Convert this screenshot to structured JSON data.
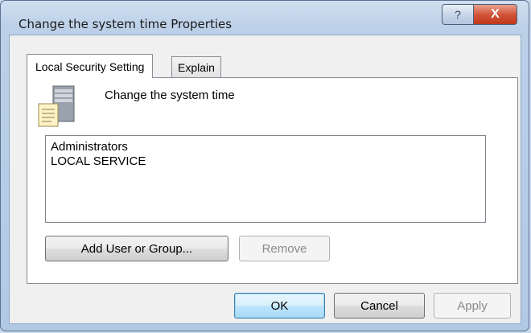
{
  "window": {
    "title": "Change the system time Properties",
    "help_symbol": "?",
    "close_symbol": "X"
  },
  "tabs": [
    {
      "label": "Local Security Setting",
      "active": true
    },
    {
      "label": "Explain",
      "active": false
    }
  ],
  "policy": {
    "name": "Change the system time",
    "icon": "server-policy-icon"
  },
  "accounts": [
    "Administrators",
    "LOCAL SERVICE"
  ],
  "buttons": {
    "add": "Add User or Group...",
    "remove": "Remove",
    "ok": "OK",
    "cancel": "Cancel",
    "apply": "Apply"
  },
  "colors": {
    "frame": "#b2c9e4",
    "close": "#c1371a",
    "default_button": "#3c7fb1"
  }
}
